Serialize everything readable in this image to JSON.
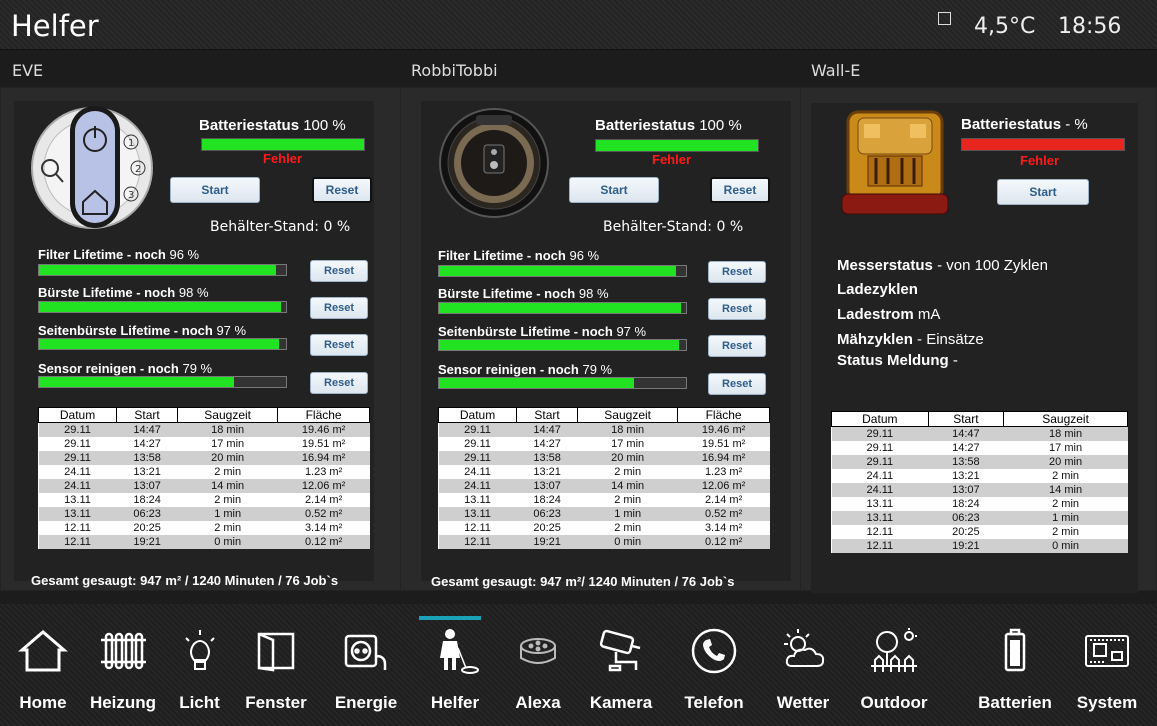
{
  "header": {
    "title": "Helfer",
    "temperature": "4,5°C",
    "time": "18:56"
  },
  "robots": [
    {
      "name": "EVE",
      "battery_label": "Batteriestatus",
      "battery_value": "100 %",
      "battery_level": 100,
      "battery_color": "#22e322",
      "error_text": "Fehler",
      "start_label": "Start",
      "reset_label": "Reset",
      "container_text": "Behälter-Stand:",
      "container_value": "0 %",
      "lifetimes": [
        {
          "label": "Filter Lifetime - noch",
          "value": "96 %",
          "level": 96,
          "reset": "Reset"
        },
        {
          "label": "Bürste Lifetime - noch",
          "value": "98 %",
          "level": 98,
          "reset": "Reset"
        },
        {
          "label": "Seitenbürste Lifetime - noch",
          "value": "97 %",
          "level": 97,
          "reset": "Reset"
        },
        {
          "label": "Sensor reinigen - noch",
          "value": "79 %",
          "level": 79,
          "reset": "Reset"
        }
      ],
      "table": {
        "headers": [
          "Datum",
          "Start",
          "Saugzeit",
          "Fläche"
        ],
        "rows": [
          [
            "29.11",
            "14:47",
            "18 min",
            "19.46 m²"
          ],
          [
            "29.11",
            "14:27",
            "17 min",
            "19.51 m²"
          ],
          [
            "29.11",
            "13:58",
            "20 min",
            "16.94 m²"
          ],
          [
            "24.11",
            "13:21",
            "2 min",
            "1.23 m²"
          ],
          [
            "24.11",
            "13:07",
            "14 min",
            "12.06 m²"
          ],
          [
            "13.11",
            "18:24",
            "2 min",
            "2.14 m²"
          ],
          [
            "13.11",
            "06:23",
            "1 min",
            "0.52 m²"
          ],
          [
            "12.11",
            "20:25",
            "2 min",
            "3.14 m²"
          ],
          [
            "12.11",
            "19:21",
            "0 min",
            "0.12 m²"
          ]
        ]
      },
      "summary": "Gesamt gesaugt: 947 m²  / 1240 Minuten / 76 Job`s"
    },
    {
      "name": "RobbiTobbi",
      "battery_label": "Batteriestatus",
      "battery_value": "100 %",
      "battery_level": 100,
      "battery_color": "#22e322",
      "error_text": "Fehler",
      "start_label": "Start",
      "reset_label": "Reset",
      "container_text": "Behälter-Stand:",
      "container_value": "0 %",
      "lifetimes": [
        {
          "label": "Filter Lifetime - noch",
          "value": "96 %",
          "level": 96,
          "reset": "Reset"
        },
        {
          "label": "Bürste Lifetime - noch",
          "value": "98 %",
          "level": 98,
          "reset": "Reset"
        },
        {
          "label": "Seitenbürste Lifetime - noch",
          "value": "97 %",
          "level": 97,
          "reset": "Reset"
        },
        {
          "label": "Sensor reinigen - noch",
          "value": "79 %",
          "level": 79,
          "reset": "Reset"
        }
      ],
      "table": {
        "headers": [
          "Datum",
          "Start",
          "Saugzeit",
          "Fläche"
        ],
        "rows": [
          [
            "29.11",
            "14:47",
            "18 min",
            "19.46 m²"
          ],
          [
            "29.11",
            "14:27",
            "17 min",
            "19.51 m²"
          ],
          [
            "29.11",
            "13:58",
            "20 min",
            "16.94 m²"
          ],
          [
            "24.11",
            "13:21",
            "2 min",
            "1.23 m²"
          ],
          [
            "24.11",
            "13:07",
            "14 min",
            "12.06 m²"
          ],
          [
            "13.11",
            "18:24",
            "2 min",
            "2.14 m²"
          ],
          [
            "13.11",
            "06:23",
            "1 min",
            "0.52 m²"
          ],
          [
            "12.11",
            "20:25",
            "2 min",
            "3.14 m²"
          ],
          [
            "12.11",
            "19:21",
            "0 min",
            "0.12 m²"
          ]
        ]
      },
      "summary": "Gesamt gesaugt: 947 m²/ 1240 Minuten  / 76 Job`s"
    },
    {
      "name": "Wall-E",
      "battery_label": "Batteriestatus",
      "battery_value": "- %",
      "battery_level": 100,
      "battery_color": "#e8261f",
      "error_text": "Fehler",
      "start_label": "Start",
      "mower": {
        "messer_label": "Messerstatus",
        "messer_value": "- von 100 Zyklen",
        "ladezyklen_label": "Ladezyklen",
        "ladestrom_label": "Ladestrom",
        "ladestrom_value": "mA",
        "maehzyklen_label": "Mähzyklen",
        "maehzyklen_value": "- Einsätze",
        "status_label": "Status Meldung",
        "status_value": "-"
      },
      "table": {
        "headers": [
          "Datum",
          "Start",
          "Saugzeit"
        ],
        "rows": [
          [
            "29.11",
            "14:47",
            "18 min"
          ],
          [
            "29.11",
            "14:27",
            "17 min"
          ],
          [
            "29.11",
            "13:58",
            "20 min"
          ],
          [
            "24.11",
            "13:21",
            "2 min"
          ],
          [
            "24.11",
            "13:07",
            "14 min"
          ],
          [
            "13.11",
            "18:24",
            "2 min"
          ],
          [
            "13.11",
            "06:23",
            "1 min"
          ],
          [
            "12.11",
            "20:25",
            "2 min"
          ],
          [
            "12.11",
            "19:21",
            "0 min"
          ]
        ]
      }
    }
  ],
  "nav": {
    "active": "Helfer",
    "active_color": "#1aa3b8",
    "items": [
      {
        "label": "Home",
        "icon": "house-icon"
      },
      {
        "label": "Heizung",
        "icon": "radiator-icon"
      },
      {
        "label": "Licht",
        "icon": "bulb-icon"
      },
      {
        "label": "Fenster",
        "icon": "window-icon"
      },
      {
        "label": "Energie",
        "icon": "power-socket-icon"
      },
      {
        "label": "Helfer",
        "icon": "robot-vacuum-person-icon"
      },
      {
        "label": "Alexa",
        "icon": "echo-dot-icon"
      },
      {
        "label": "Kamera",
        "icon": "camera-icon"
      },
      {
        "label": "Telefon",
        "icon": "phone-icon"
      },
      {
        "label": "Wetter",
        "icon": "weather-icon"
      },
      {
        "label": "Outdoor",
        "icon": "tree-icon"
      },
      {
        "label": "Batterien",
        "icon": "battery-icon"
      },
      {
        "label": "System",
        "icon": "circuit-board-icon"
      }
    ]
  }
}
